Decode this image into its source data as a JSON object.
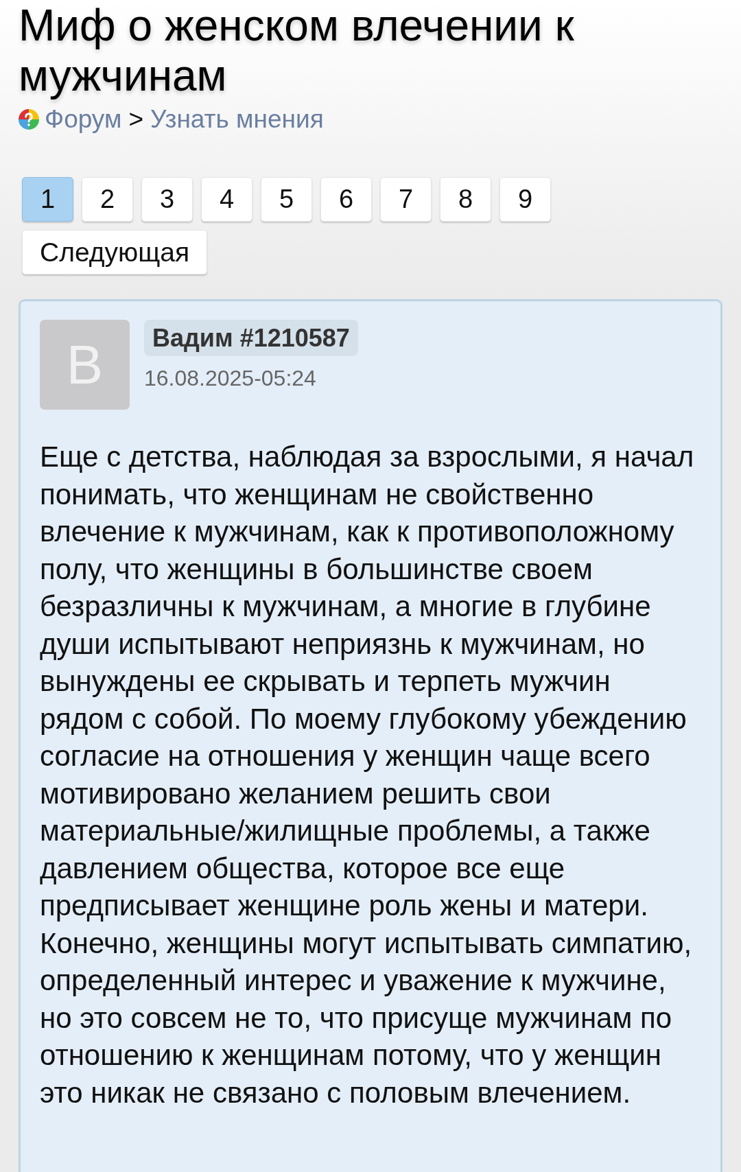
{
  "page": {
    "title": "Миф о женском влечении к мужчинам"
  },
  "breadcrumb": {
    "items": [
      {
        "label": "Форум"
      },
      {
        "label": "Узнать мнения"
      }
    ],
    "separator": ">"
  },
  "pagination": {
    "pages": [
      {
        "label": "1",
        "selected": true
      },
      {
        "label": "2",
        "selected": false
      },
      {
        "label": "3",
        "selected": false
      },
      {
        "label": "4",
        "selected": false
      },
      {
        "label": "5",
        "selected": false
      },
      {
        "label": "6",
        "selected": false
      },
      {
        "label": "7",
        "selected": false
      },
      {
        "label": "8",
        "selected": false
      },
      {
        "label": "9",
        "selected": false
      }
    ],
    "next": "Следующая"
  },
  "post": {
    "avatar_letter": "В",
    "author": "Вадим #1210587",
    "date": "16.08.2025-05:24",
    "text": "Еще с детства, наблюдая за взрослыми, я начал понимать, что женщинам не свойственно влечение к мужчинам, как к противоположному полу, что женщины в большинстве своем безразличны к мужчинам, а многие в глубине души испытывают неприязнь к мужчинам, но вынуждены ее скрывать и терпеть мужчин рядом с собой. По моему глубокому убеждению согласие на отношения у женщин чаще всего мотивировано желанием решить свои материальные/жилищные проблемы, а также давлением общества, которое все еще предписывает женщине роль жены и матери. Конечно, женщины могут испытывать симпатию, определенный интерес и уважение к мужчине, но это совсем не то, что присуще мужчинам по отношению к женщинам потому, что у женщин это никак не связано с половым влечением."
  }
}
